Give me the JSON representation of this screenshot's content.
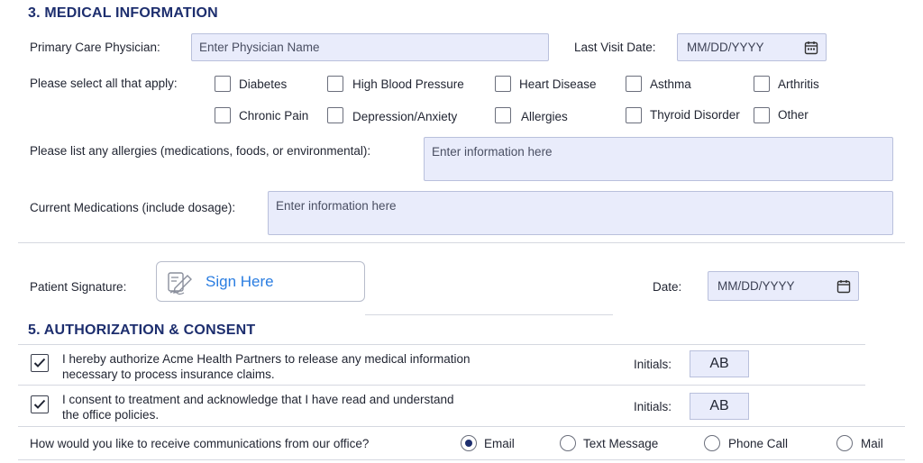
{
  "medical": {
    "title": "3. MEDICAL INFORMATION",
    "physician_label": "Primary Care Physician:",
    "physician_placeholder": "Enter Physician Name",
    "last_visit_label": "Last Visit Date:",
    "last_visit_placeholder": "MM/DD/YYYY",
    "select_label": "Please select all that apply:",
    "conditions": [
      "Diabetes",
      "High Blood Pressure",
      "Heart Disease",
      "Asthma",
      "Arthritis",
      "Chronic Pain",
      "Depression/Anxiety",
      "Allergies",
      "Thyroid Disorder",
      "Other"
    ],
    "allergies_label": "Please list any allergies (medications, foods, or environmental):",
    "allergies_placeholder": "Enter information here",
    "medications_label": "Current Medications (include dosage):",
    "medications_placeholder": "Enter information here"
  },
  "signature": {
    "label": "Patient Signature:",
    "sign_text": "Sign Here",
    "date_label": "Date:",
    "date_placeholder": "MM/DD/YYYY"
  },
  "authorization": {
    "title": "5. AUTHORIZATION & CONSENT",
    "items": [
      {
        "line1": "I hereby authorize Acme Health Partners to release any medical information",
        "line2": "necessary to process insurance claims.",
        "initials_label": "Initials:",
        "initials": "AB",
        "checked": true
      },
      {
        "line1": "I consent to treatment and acknowledge that I have read and understand",
        "line2": "the office policies.",
        "initials_label": "Initials:",
        "initials": "AB",
        "checked": true
      }
    ],
    "comm_question": "How would you like to receive communications from our office?",
    "comm_options": [
      "Email",
      "Text Message",
      "Phone Call",
      "Mail"
    ],
    "comm_selected": "Email"
  },
  "colors": {
    "heading": "#1d2e6e",
    "field_bg": "#e9ecfb",
    "sign_blue": "#2a7de1"
  }
}
